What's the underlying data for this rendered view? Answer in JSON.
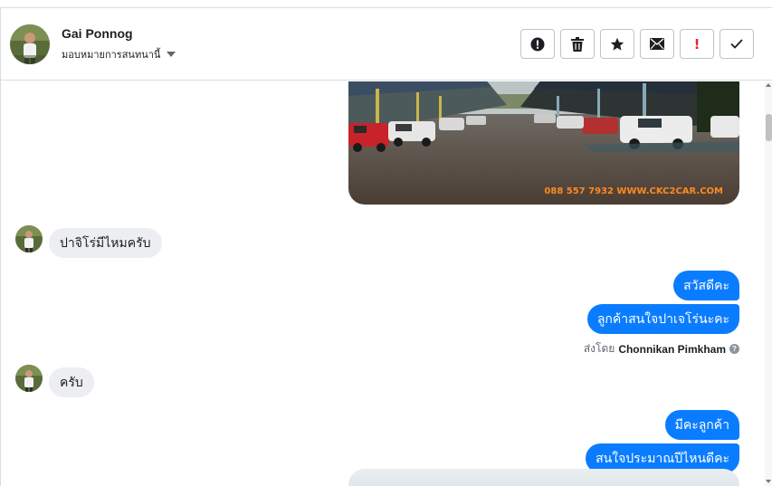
{
  "header": {
    "contact_name": "Gai Ponnog",
    "assign_label": "มอบหมายการสนทนานี้",
    "actions": [
      {
        "icon": "alert-circle-icon",
        "label": "spam"
      },
      {
        "icon": "trash-icon",
        "label": "delete"
      },
      {
        "icon": "star-icon",
        "label": "star"
      },
      {
        "icon": "envelope-icon",
        "label": "mark unread"
      },
      {
        "icon": "exclamation-icon",
        "label": "follow up"
      },
      {
        "icon": "check-icon",
        "label": "done"
      }
    ]
  },
  "photo": {
    "watermark": "088 557 7932 WWW.CKC2CAR.COM"
  },
  "messages": [
    {
      "from": "customer",
      "text": "ปาจิโร่มีไหมครับ"
    },
    {
      "from": "page",
      "text": "สวัสดีคะ"
    },
    {
      "from": "page",
      "text": "ลูกค้าสนใจปาเจโร่นะคะ"
    },
    {
      "from": "customer",
      "text": "ครับ"
    },
    {
      "from": "page",
      "text": "มีคะลูกค้า"
    },
    {
      "from": "page",
      "text": "สนใจประมาณปีไหนดีคะ"
    }
  ],
  "sent_by": {
    "prefix": "ส่งโดย",
    "name": "Chonnikan Pimkham",
    "help": "?"
  },
  "colors": {
    "outgoing_bubble": "#0a7cff",
    "incoming_bubble": "#eceef1",
    "border": "#dadde1",
    "alert_red": "#e02c2c"
  }
}
